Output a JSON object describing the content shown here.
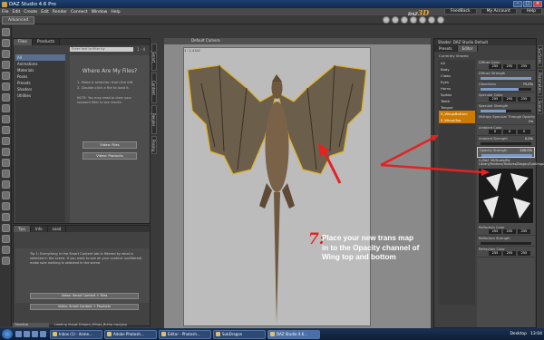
{
  "window": {
    "title": "DAZ Studio 4.6 Pro"
  },
  "menu": {
    "items": [
      "File",
      "Edit",
      "Create",
      "Edit",
      "Render",
      "Connect",
      "Window",
      "Help"
    ],
    "brand": "DAZ",
    "brand_accent": "3D",
    "links": [
      "FeedBack",
      "My Account",
      "Help"
    ]
  },
  "mode_tab": "Advanced",
  "content_library": {
    "tabs": [
      "Files",
      "Products"
    ],
    "search_placeholder": "Enter text to filter by",
    "count": "1 - 4",
    "tree": [
      "All",
      "Animations",
      "Materials",
      "Poses",
      "Presets",
      "Shaders",
      "Utilities"
    ],
    "help_title": "Where Are My Files?",
    "steps": [
      "1. Make a selection from the left",
      "2. Double-click a file to load it."
    ],
    "note": "NOTE: You may need to clear your keyword filter to see results.",
    "video_tips": [
      "Video: Files",
      "Video: Products"
    ],
    "side_tabs": [
      "Smart Content",
      "Content Library",
      "Render Settings",
      "Posing"
    ]
  },
  "tips": {
    "tabs": [
      "Tips",
      "Info",
      "Load"
    ],
    "text": "Tip 1: Everything in the Smart Content tab is filtered by what is selected in the scene. If you want to see all your content (unfiltered) make sure nothing is selected in the scene.",
    "buttons": [
      "Video: Smart Content + Files",
      "Video: Smart Content + Products"
    ]
  },
  "viewport": {
    "camera": "Default Camera",
    "frame_label": "1 : 1.4142"
  },
  "right_panel": {
    "header": "Shader: DAZ Studio Default",
    "tabs": [
      "Editor",
      "Presets"
    ],
    "view_label": "Currently Viewed",
    "scene_items": [
      "All",
      "Body",
      "Claws",
      "Eyes",
      "Horns",
      "Spikes",
      "Teeth",
      "Tongue",
      "5_WingsBottom",
      "5_WingsTop"
    ],
    "properties": [
      {
        "label": "Diffuse Color",
        "rgb": [
          "255",
          "255",
          "255"
        ]
      },
      {
        "label": "Diffuse Strength",
        "value": "",
        "fill": 1.0
      },
      {
        "label": "Glossiness",
        "value": "75.0%",
        "fill": 0.75
      },
      {
        "label": "Specular Color",
        "rgb": [
          "255",
          "255",
          "255"
        ]
      },
      {
        "label": "Specular Strength",
        "value": "",
        "fill": 0.5
      },
      {
        "label": "Multiply Specular Through Opacity",
        "value": "On"
      },
      {
        "label": "Ambient Color",
        "rgb": [
          "0",
          "0",
          "0"
        ]
      },
      {
        "label": "Ambient Strength",
        "value": "0.0%",
        "fill": 0.0
      },
      {
        "label": "Opacity Strength",
        "value": "100.0%",
        "fill": 1.0
      }
    ],
    "opacity_path": "C:/DAZ 3D/Studio/My Library/Runtime/Textures/Dragon/SubDragon_Wings_Trans.jpg",
    "lower_properties": [
      {
        "label": "Reflection Color",
        "rgb": [
          "255",
          "255",
          "255"
        ]
      },
      {
        "label": "Reflection Strength",
        "fill": 0.0
      },
      {
        "label": "Refraction Color",
        "rgb": [
          "255",
          "255",
          "255"
        ]
      }
    ],
    "show_sub_items": "Show Sub Items",
    "side_tabs": [
      "Surfaces",
      "Parameters",
      "Scene"
    ]
  },
  "timeline": "Timeline",
  "status_text": "Loading image Dragon_Wings_Bump copy.jpg",
  "annotation": {
    "number": "7:",
    "text": "Place your new trans map in to the Opacity channel of Wing top and bottom",
    "color": "#e52222"
  },
  "taskbar": {
    "tasks": [
      "Inbox (1) - itsme...",
      "Adobe Photosh...",
      "Editor - Photosh...",
      "SubDragon",
      "DAZ Studio 4.6..."
    ],
    "tray_label": "Desktop",
    "time": "13:04"
  }
}
